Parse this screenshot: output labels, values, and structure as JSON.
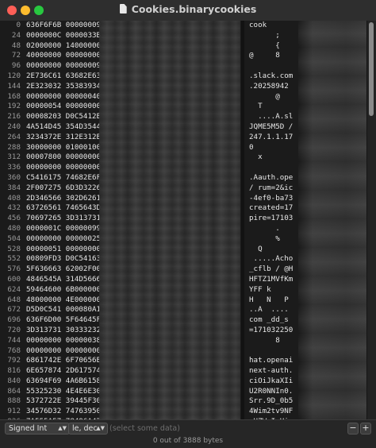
{
  "window": {
    "title": "Cookies.binarycookies"
  },
  "offsets": [
    "0",
    "24",
    "48",
    "72",
    "96",
    "120",
    "144",
    "168",
    "192",
    "216",
    "240",
    "264",
    "288",
    "312",
    "336",
    "360",
    "384",
    "408",
    "432",
    "456",
    "480",
    "504",
    "528",
    "552",
    "576",
    "600",
    "624",
    "648",
    "672",
    "696",
    "720",
    "744",
    "768",
    "792",
    "816",
    "840",
    "864",
    "888",
    "912",
    "936"
  ],
  "hex": [
    "636F6F6B 00000009",
    "0000000C 0000033B",
    "02000000 14000000",
    "40000000 00000000",
    "00000000 00000009",
    "2E736C61 63682E63",
    "2E323032 35383934",
    "00000000 00000040",
    "00000054 00000000",
    "00008203 D0C5412E",
    "4A514D45 354D3544",
    "3234372E 312E312E",
    "30000000 01000100",
    "00007800 00000000",
    "00000000 00000000",
    "C5416175 74682E6F",
    "2F007275 6D3D3226",
    "2D346566 302D6261",
    "63726561 7465643D",
    "70697265 3D313731",
    "0000001C 00000099",
    "00000000 00000025",
    "00000051 00000000",
    "00809FD3 D0C54163",
    "5F636663 62002F00",
    "4846545A 314D5666",
    "59464600 6B000000",
    "48000000 4E000000",
    "D5D0C541 000080A1",
    "636F6D00 5F64645F",
    "3D313731 30333232",
    "00000000 00000038",
    "00000000 00000000",
    "6861742E 6F70656E",
    "6E657874 2D617574",
    "63694F69 4A6B6158",
    "55325230 4E4E6E30",
    "5372722E 39445F30",
    "34576D32 74763950",
    "7A555A57 78496A47"
  ],
  "ascii": [
    "cook",
    "      ;",
    "      {",
    "@     8",
    "",
    ".slack.com",
    ".20258942",
    "      @",
    "  T",
    "  ....A.sl",
    "JQME5M5D /",
    "247.1.1.17",
    "0",
    "  x",
    "",
    ".Aauth.ope",
    "/ rum=2&ic",
    "-4ef0-ba73",
    "created=17",
    "pire=17103",
    "      .",
    "      %",
    "  Q",
    " .....Acho",
    "_cflb / @H",
    "HFTZ1MVfKm",
    "YFF k",
    "H   N   P",
    "..A  ....",
    "com _dd_s",
    "=171032250",
    "      8",
    "",
    "hat.openai",
    "next-auth.",
    "ciOiJkaXIi",
    "U2R0NNIn0.",
    "Srr.9D_0b5",
    "4Wim2tv9NF",
    "zUZWxIqHi"
  ],
  "bottom": {
    "type_select": "Signed Int",
    "endian_select": "le, dec",
    "data_placeholder": "(select some data)",
    "minus_label": "−",
    "plus_label": "+",
    "status": "0 out of 3888 bytes"
  }
}
